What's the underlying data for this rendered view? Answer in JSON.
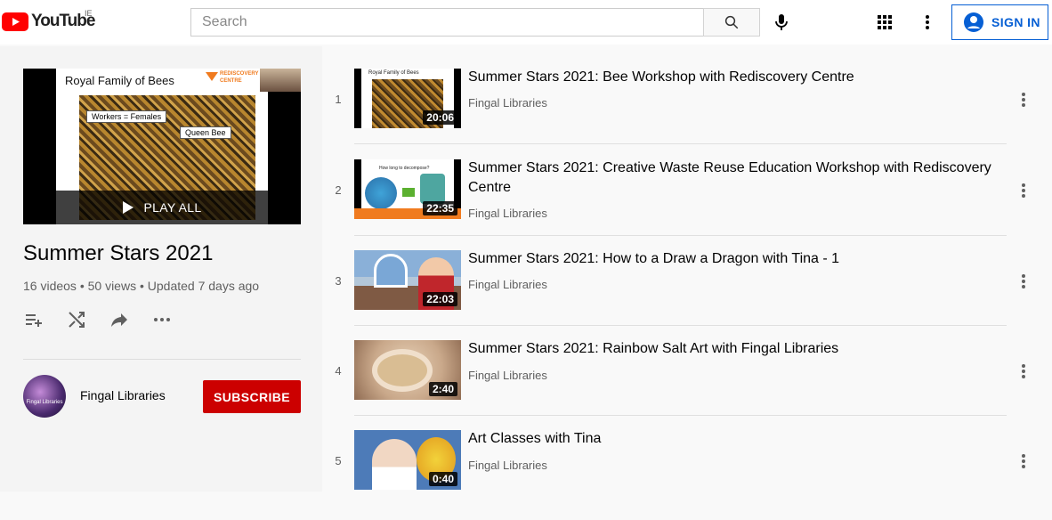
{
  "header": {
    "logo_text": "YouTube",
    "region": "IE",
    "search_placeholder": "Search",
    "sign_in_label": "SIGN IN"
  },
  "playlist": {
    "thumbnail": {
      "slide_title": "Royal Family of Bees",
      "brand_line1": "REDISCOVERY",
      "brand_line2": "CENTRE",
      "tag_workers": "Workers = Females",
      "tag_queen": "Queen Bee"
    },
    "play_all_label": "PLAY ALL",
    "title": "Summer Stars 2021",
    "stats": "16 videos • 50 views • Updated 7 days ago",
    "owner": {
      "name": "Fingal Libraries",
      "avatar_text": "Fingal Libraries"
    },
    "subscribe_label": "SUBSCRIBE"
  },
  "videos": [
    {
      "index": "1",
      "title": "Summer Stars 2021: Bee Workshop with Rediscovery Centre",
      "channel": "Fingal Libraries",
      "duration": "20:06",
      "thumb_text": "Royal Family of Bees"
    },
    {
      "index": "2",
      "title": "Summer Stars 2021: Creative Waste Reuse Education Workshop with Rediscovery Centre",
      "channel": "Fingal Libraries",
      "duration": "22:35",
      "thumb_text": "How long to decompose?"
    },
    {
      "index": "3",
      "title": "Summer Stars 2021: How to a Draw a Dragon with Tina - 1",
      "channel": "Fingal Libraries",
      "duration": "22:03"
    },
    {
      "index": "4",
      "title": "Summer Stars 2021: Rainbow Salt Art with Fingal Libraries",
      "channel": "Fingal Libraries",
      "duration": "2:40"
    },
    {
      "index": "5",
      "title": "Art Classes with Tina",
      "channel": "Fingal Libraries",
      "duration": "0:40"
    }
  ],
  "colors": {
    "brand_red": "#ff0000",
    "subscribe_red": "#cc0000",
    "link_blue": "#065fd4"
  }
}
